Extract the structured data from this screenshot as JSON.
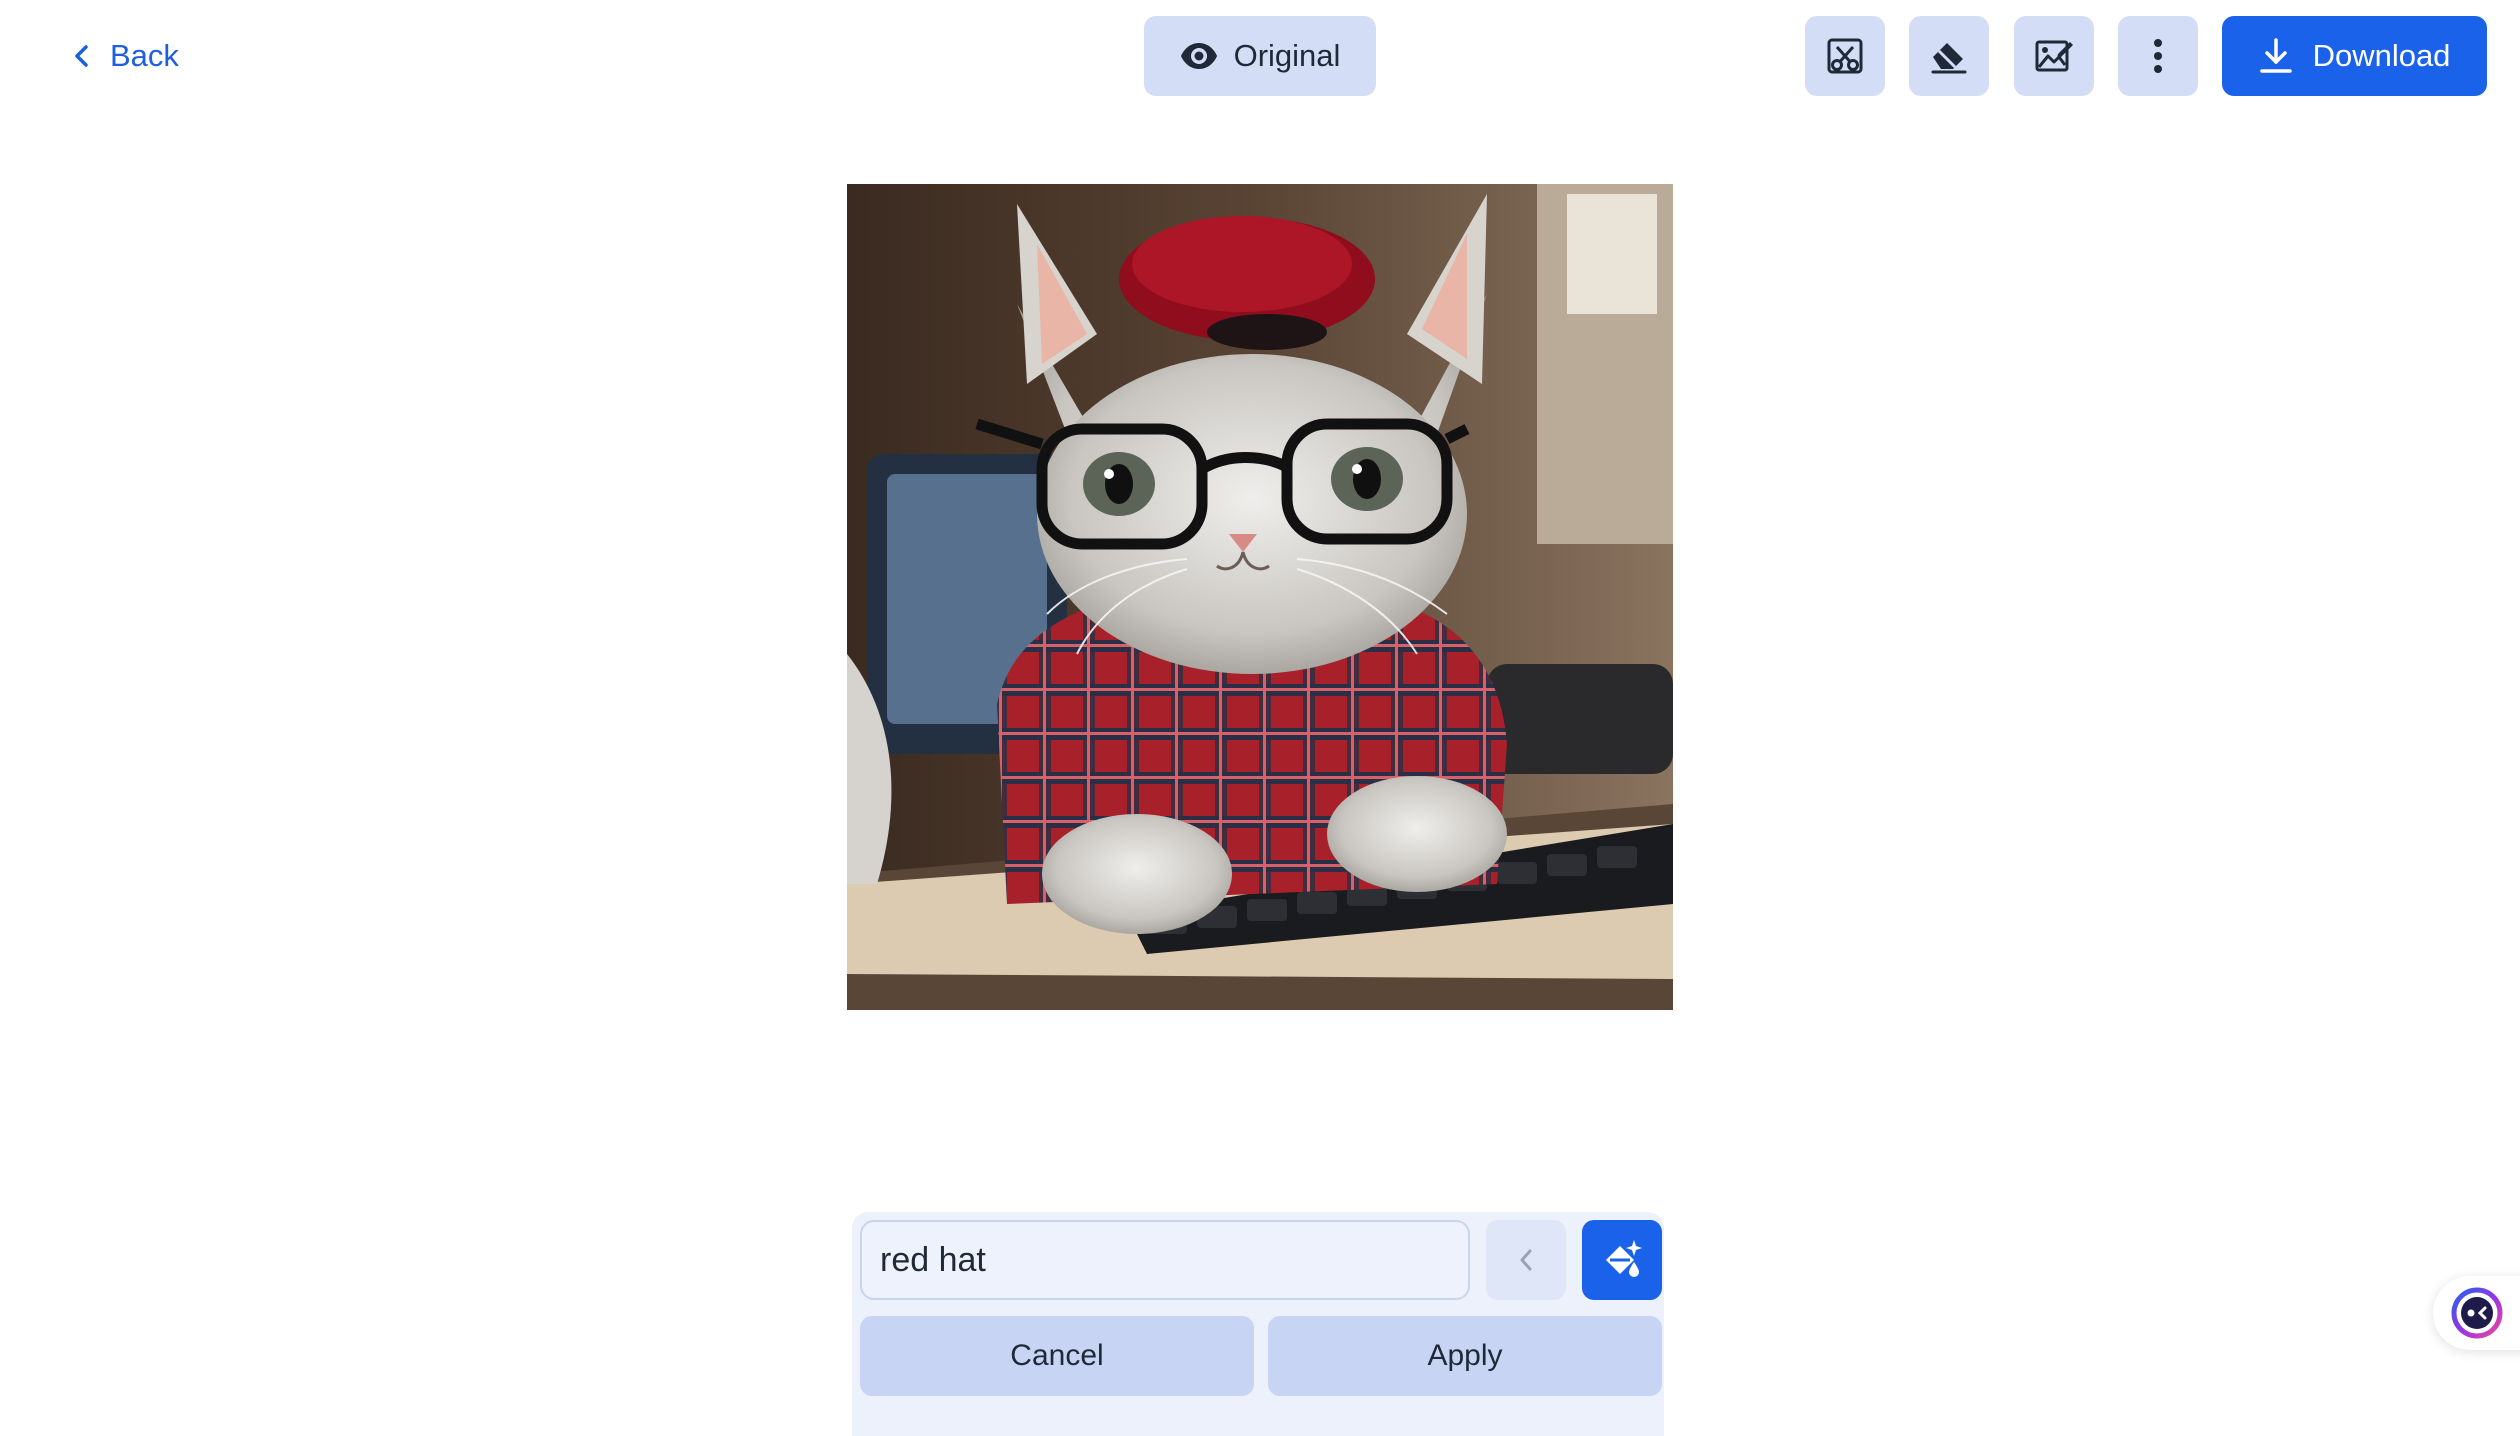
{
  "header": {
    "back_label": "Back",
    "original_label": "Original",
    "download_label": "Download",
    "toolbar_icons": [
      "crop-icon",
      "eraser-icon",
      "edit-image-icon",
      "more-vertical-icon"
    ]
  },
  "image": {
    "subject": "kitten wearing red beret, black glasses and plaid shirt at keyboard"
  },
  "prompt": {
    "value": "red hat",
    "cancel_label": "Cancel",
    "apply_label": "Apply"
  },
  "colors": {
    "accent": "#1a62ea",
    "button_bg": "#d3ddf6",
    "panel_bg": "#edf1fb"
  }
}
